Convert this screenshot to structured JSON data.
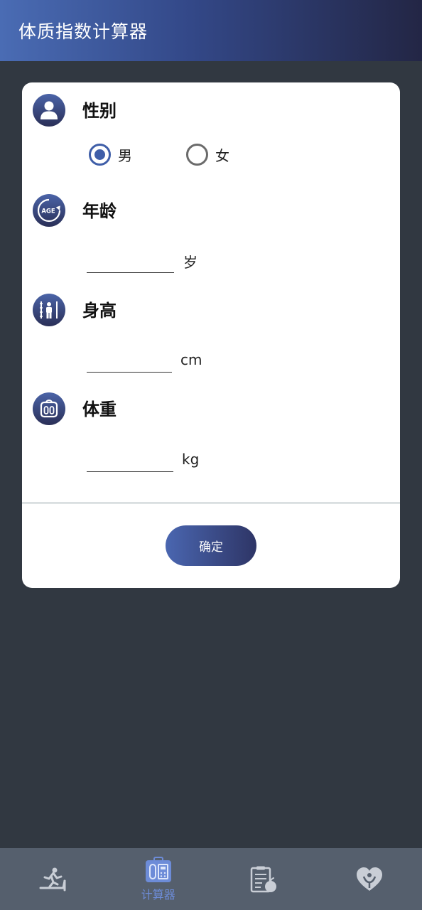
{
  "header": {
    "title": "体质指数计算器"
  },
  "form": {
    "gender": {
      "label": "性别",
      "options": [
        {
          "label": "男",
          "checked": true
        },
        {
          "label": "女",
          "checked": false
        }
      ]
    },
    "age": {
      "label": "年龄",
      "value": "",
      "unit": "岁"
    },
    "height": {
      "label": "身高",
      "value": "",
      "unit": "cm"
    },
    "weight": {
      "label": "体重",
      "value": "",
      "unit": "kg"
    },
    "confirm_label": "确定"
  },
  "bottom_nav": {
    "items": [
      {
        "icon": "treadmill-icon",
        "label": ""
      },
      {
        "icon": "calculator-icon",
        "label": "计算器",
        "active": true
      },
      {
        "icon": "diet-clipboard-icon",
        "label": ""
      },
      {
        "icon": "heart-care-icon",
        "label": ""
      }
    ]
  },
  "colors": {
    "accent": "#3f5ea8",
    "header_start": "#4a6cb4",
    "header_end": "#232645",
    "background": "#313841",
    "nav_bg": "#555f6d",
    "nav_active": "#6d8cd8"
  }
}
